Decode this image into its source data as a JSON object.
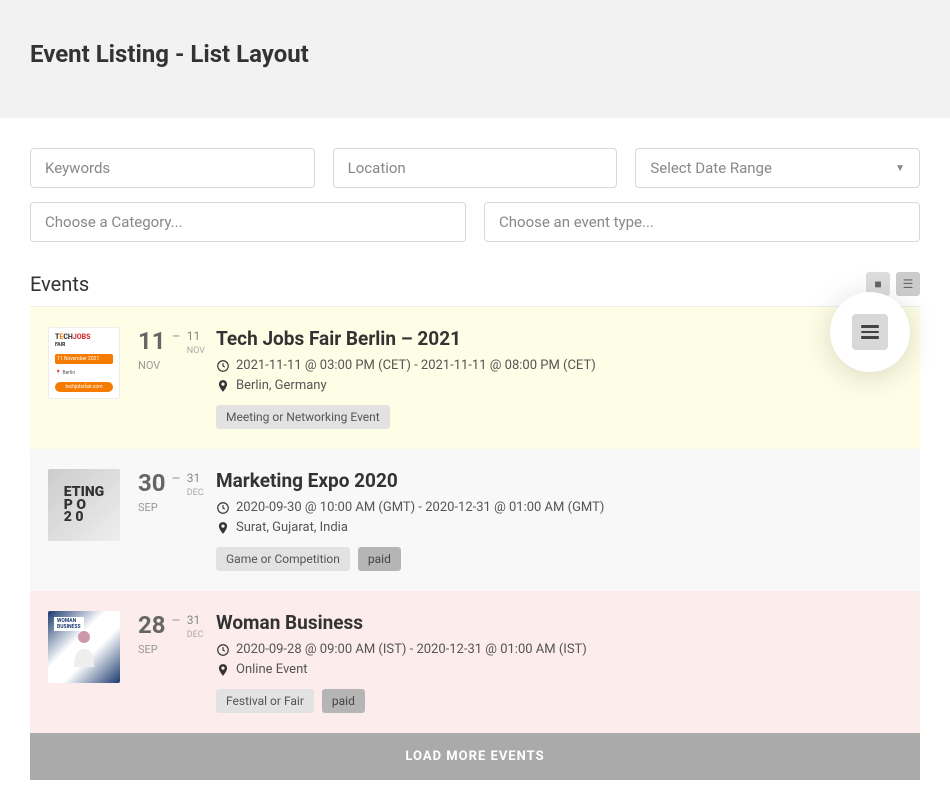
{
  "header": {
    "title": "Event Listing - List Layout"
  },
  "filters": {
    "keywords_placeholder": "Keywords",
    "location_placeholder": "Location",
    "daterange_placeholder": "Select Date Range",
    "category_placeholder": "Choose a Category...",
    "type_placeholder": "Choose an event type..."
  },
  "section": {
    "title": "Events"
  },
  "events": [
    {
      "start_day": "11",
      "start_mon": "NOV",
      "end_day": "11",
      "end_mon": "NOV",
      "title": "Tech Jobs Fair Berlin – 2021",
      "datetime": "2021-11-11 @ 03:00 PM (CET) - 2021-11-11 @ 08:00 PM (CET)",
      "location": "Berlin, Germany",
      "tags": [
        {
          "label": "Meeting or Networking Event",
          "dark": false
        }
      ]
    },
    {
      "start_day": "30",
      "start_mon": "SEP",
      "end_day": "31",
      "end_mon": "DEC",
      "title": "Marketing Expo 2020",
      "datetime": "2020-09-30 @ 10:00 AM (GMT) - 2020-12-31 @ 01:00 AM (GMT)",
      "location": "Surat, Gujarat, India",
      "tags": [
        {
          "label": "Game or Competition",
          "dark": false
        },
        {
          "label": "paid",
          "dark": true
        }
      ]
    },
    {
      "start_day": "28",
      "start_mon": "SEP",
      "end_day": "31",
      "end_mon": "DEC",
      "title": "Woman Business",
      "datetime": "2020-09-28 @ 09:00 AM (IST) - 2020-12-31 @ 01:00 AM (IST)",
      "location": "Online Event",
      "tags": [
        {
          "label": "Festival or Fair",
          "dark": false
        },
        {
          "label": "paid",
          "dark": true
        }
      ]
    }
  ],
  "load_more": "LOAD MORE EVENTS"
}
